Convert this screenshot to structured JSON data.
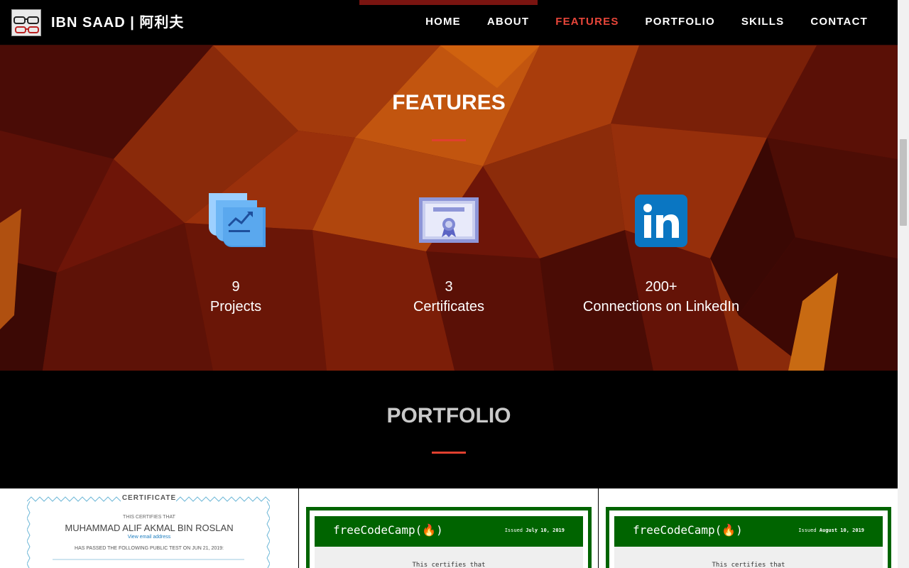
{
  "nav": {
    "brand": "IBN SAAD | 阿利夫",
    "links": [
      {
        "label": "HOME",
        "active": false
      },
      {
        "label": "ABOUT",
        "active": false
      },
      {
        "label": "FEATURES",
        "active": true
      },
      {
        "label": "PORTFOLIO",
        "active": false
      },
      {
        "label": "SKILLS",
        "active": false
      },
      {
        "label": "CONTACT",
        "active": false
      }
    ]
  },
  "features": {
    "title": "FEATURES",
    "items": [
      {
        "count": "9",
        "label": "Projects",
        "icon": "projects-chart-icon"
      },
      {
        "count": "3",
        "label": "Certificates",
        "icon": "certificate-icon"
      },
      {
        "count": "200+",
        "label": "Connections on LinkedIn",
        "icon": "linkedin-icon"
      }
    ]
  },
  "portfolio": {
    "title": "PORTFOLIO",
    "cert1": {
      "title": "CERTIFICATE",
      "certifies": "THIS CERTIFIES THAT",
      "name": "MUHAMMAD ALIF AKMAL BIN ROSLAN",
      "link": "View email address",
      "passed": "HAS PASSED THE FOLLOWING PUBLIC TEST ON JUN 21, 2019:"
    },
    "cert2": {
      "logo": "freeCodeCamp(🔥)",
      "issued_prefix": "Issued",
      "issued_date": "July 10, 2019",
      "certifies": "This certifies that"
    },
    "cert3": {
      "logo": "freeCodeCamp(🔥)",
      "issued_prefix": "Issued",
      "issued_date": "August 10, 2019",
      "certifies": "This certifies that"
    }
  },
  "colors": {
    "accent": "#e8463a",
    "features_bg": "#7a1a08",
    "fcc_green": "#006400",
    "linkedin_blue": "#0a76c2"
  }
}
